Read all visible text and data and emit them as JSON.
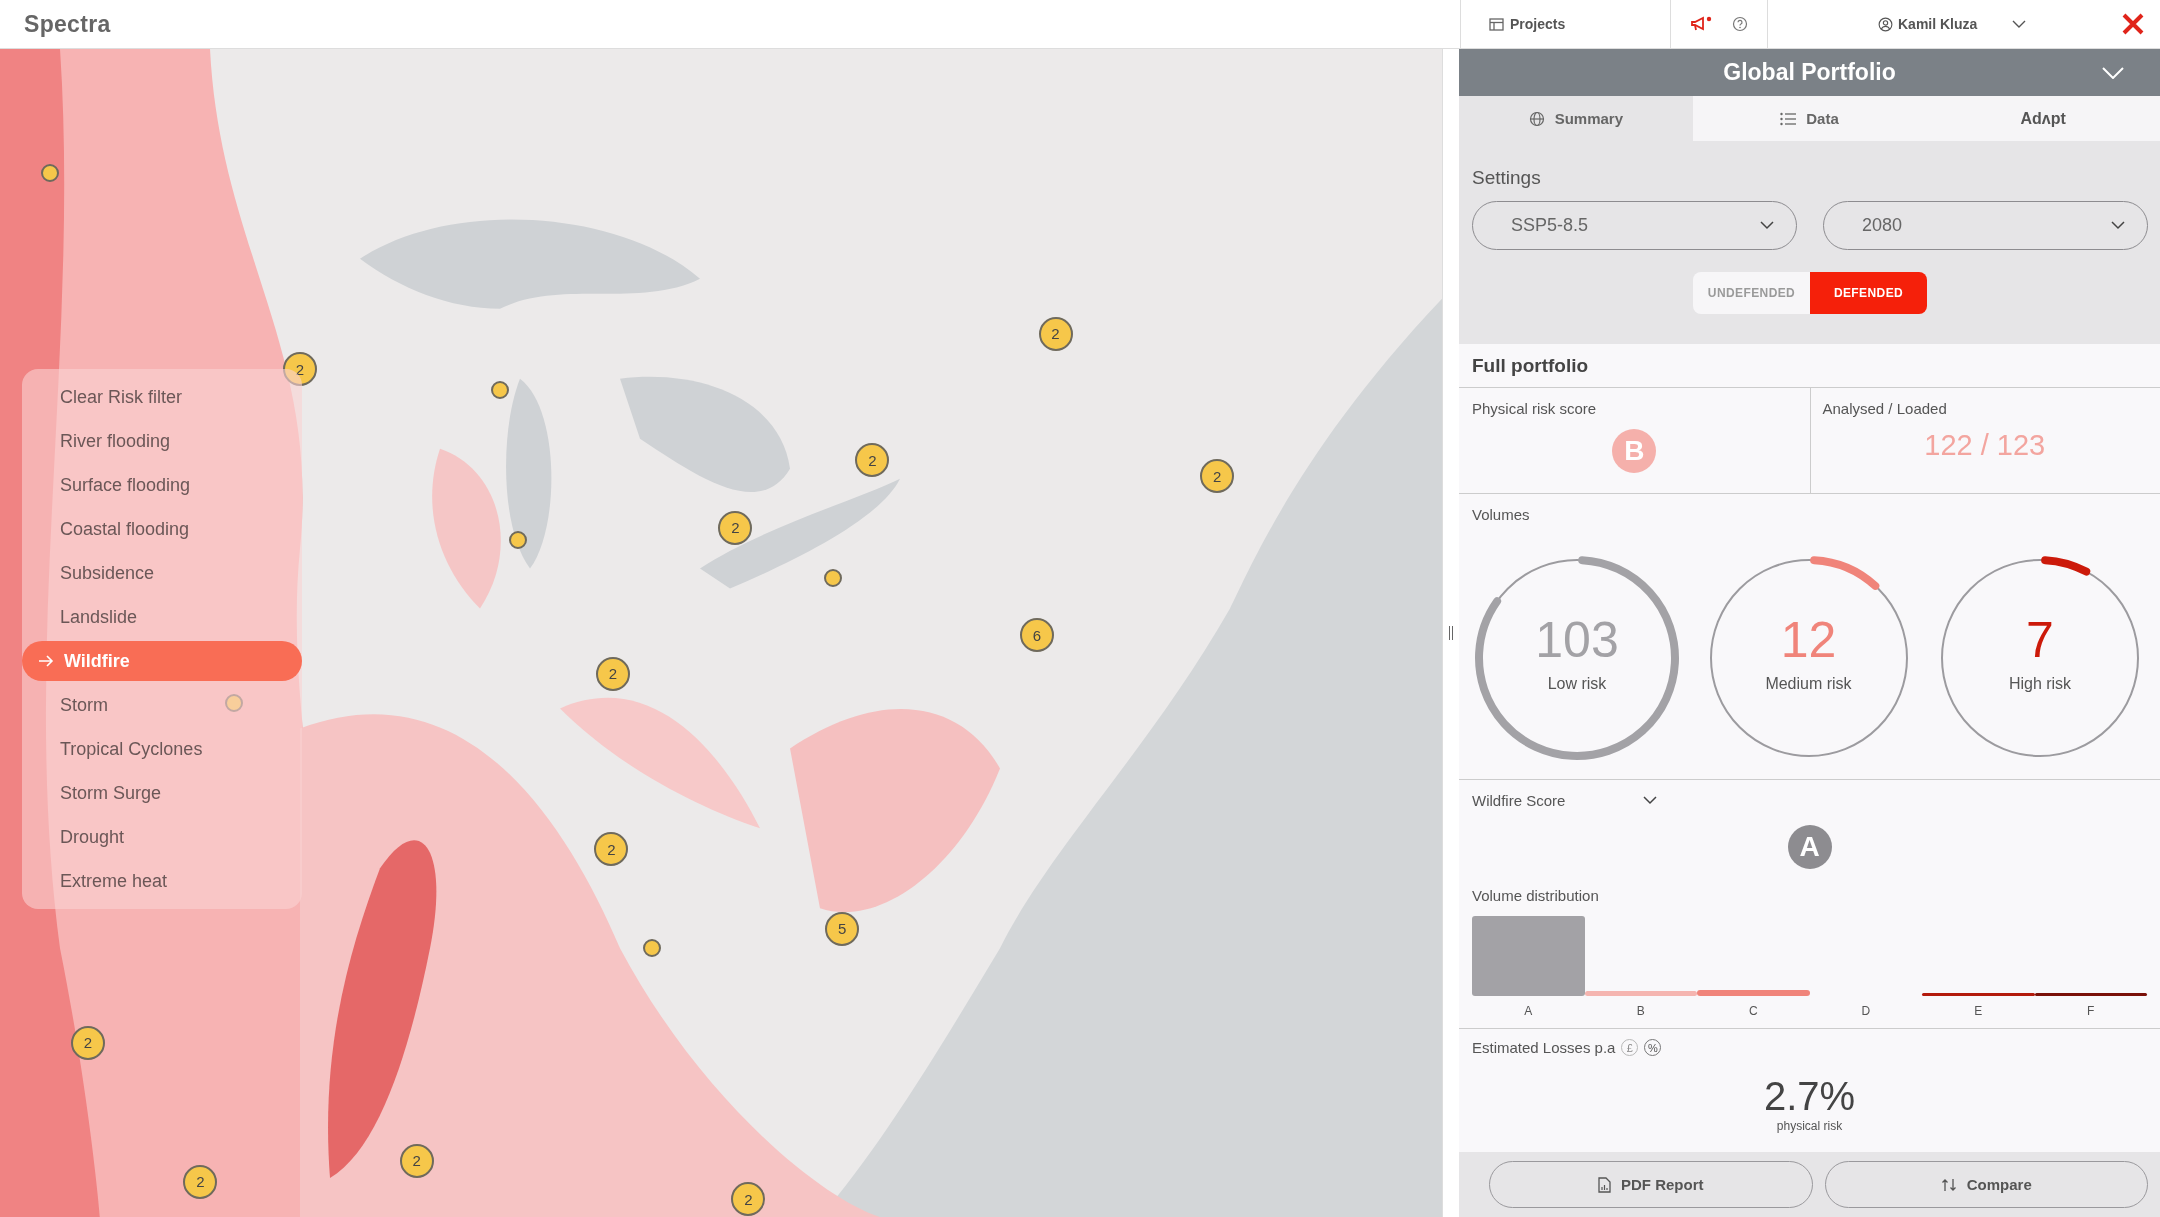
{
  "app": {
    "logo": "Spectra"
  },
  "top_bar": {
    "projects": "Projects",
    "user": "Kamil Kluza",
    "notification": true
  },
  "risk_filter": {
    "clear": "Clear Risk filter",
    "items": [
      {
        "label": "River flooding",
        "selected": false
      },
      {
        "label": "Surface flooding",
        "selected": false
      },
      {
        "label": "Coastal flooding",
        "selected": false
      },
      {
        "label": "Subsidence",
        "selected": false
      },
      {
        "label": "Landslide",
        "selected": false
      },
      {
        "label": "Wildfire",
        "selected": true
      },
      {
        "label": "Storm",
        "selected": false
      },
      {
        "label": "Tropical Cyclones",
        "selected": false
      },
      {
        "label": "Storm Surge",
        "selected": false
      },
      {
        "label": "Drought",
        "selected": false
      },
      {
        "label": "Extreme heat",
        "selected": false
      }
    ]
  },
  "map_markers": [
    {
      "kind": "cluster",
      "count": "2"
    },
    {
      "kind": "cluster",
      "count": "2"
    },
    {
      "kind": "cluster",
      "count": "2"
    },
    {
      "kind": "cluster",
      "count": "2"
    },
    {
      "kind": "cluster",
      "count": "2"
    },
    {
      "kind": "cluster",
      "count": "2"
    },
    {
      "kind": "cluster",
      "count": "6"
    },
    {
      "kind": "cluster",
      "count": "2"
    },
    {
      "kind": "cluster",
      "count": "5"
    },
    {
      "kind": "cluster",
      "count": "2"
    },
    {
      "kind": "cluster",
      "count": "2"
    },
    {
      "kind": "cluster",
      "count": "2"
    },
    {
      "kind": "cluster",
      "count": "2"
    },
    {
      "kind": "site"
    },
    {
      "kind": "site"
    },
    {
      "kind": "site"
    },
    {
      "kind": "site"
    },
    {
      "kind": "site"
    },
    {
      "kind": "site"
    }
  ],
  "panel": {
    "title": "Global Portfolio",
    "tabs": [
      {
        "label": "Summary",
        "kind": "globe",
        "selected": true
      },
      {
        "label": "Data",
        "kind": "list",
        "selected": false
      },
      {
        "label": "Adʌpt",
        "kind": "text",
        "selected": false
      }
    ],
    "settings": {
      "title": "Settings",
      "scenario": "SSP5-8.5",
      "year": "2080",
      "defence": [
        {
          "label": "UNDEFENDED",
          "selected": false
        },
        {
          "label": "DEFENDED",
          "selected": true
        }
      ]
    },
    "full_portfolio": {
      "title": "Full portfolio",
      "score_label": "Physical risk score",
      "score": "B",
      "analysed_label": "Analysed / Loaded",
      "analysed": "122 / 123"
    },
    "volumes": {
      "title": "Volumes",
      "meters": [
        {
          "value": "103",
          "label": "Low risk",
          "level": 0.84,
          "color": "#a3a2a6"
        },
        {
          "value": "12",
          "label": "Medium risk",
          "level": 0.11,
          "color": "#f0847a"
        },
        {
          "value": "7",
          "label": "High risk",
          "level": 0.07,
          "color": "#cc1a0a"
        }
      ]
    },
    "hazard_score": {
      "title": "Wildfire Score",
      "score": "A",
      "distribution_title": "Volume distribution",
      "categories": [
        "A",
        "B",
        "C",
        "D",
        "E",
        "F"
      ]
    },
    "losses": {
      "title": "Estimated Losses p.a",
      "units": [
        {
          "label": "£",
          "selected": false
        },
        {
          "label": "%",
          "selected": true
        }
      ],
      "value": "2.7%",
      "caption": "physical risk"
    },
    "buttons": [
      {
        "label": "PDF Report",
        "kind": "report"
      },
      {
        "label": "Compare",
        "kind": "compare"
      }
    ]
  }
}
